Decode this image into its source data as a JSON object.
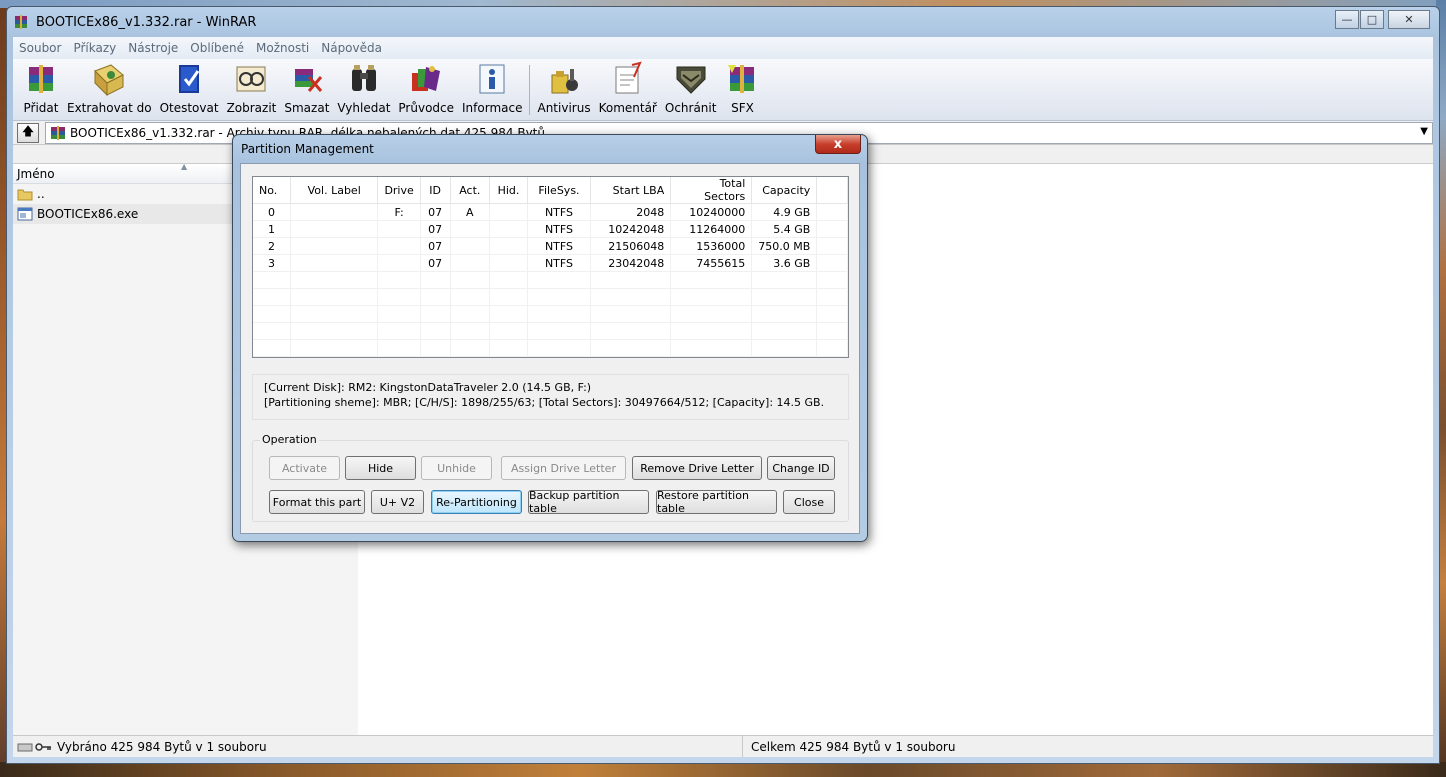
{
  "window": {
    "title": "BOOTICEx86_v1.332.rar - WinRAR",
    "min": "—",
    "max": "□",
    "close": "✕"
  },
  "menu": [
    "Soubor",
    "Příkazy",
    "Nástroje",
    "Oblíbené",
    "Možnosti",
    "Nápověda"
  ],
  "toolbar": [
    {
      "label": "Přidat",
      "icon": "add-archive-icon"
    },
    {
      "label": "Extrahovat do",
      "icon": "extract-icon"
    },
    {
      "label": "Otestovat",
      "icon": "test-icon"
    },
    {
      "label": "Zobrazit",
      "icon": "view-icon"
    },
    {
      "label": "Smazat",
      "icon": "delete-icon"
    },
    {
      "label": "Vyhledat",
      "icon": "find-icon"
    },
    {
      "label": "Průvodce",
      "icon": "wizard-icon"
    },
    {
      "label": "Informace",
      "icon": "info-icon"
    },
    {
      "label": "Antivirus",
      "icon": "antivirus-icon"
    },
    {
      "label": "Komentář",
      "icon": "comment-icon"
    },
    {
      "label": "Ochránit",
      "icon": "protect-icon"
    },
    {
      "label": "SFX",
      "icon": "sfx-icon"
    }
  ],
  "address": {
    "text": "BOOTICEx86_v1.332.rar - Archiv typu RAR, délka nebalených dat 425 984 Bytů"
  },
  "filelist": {
    "column_name": "Jméno",
    "rows": [
      {
        "name": ".."
      },
      {
        "name": "BOOTICEx86.exe"
      }
    ]
  },
  "status": {
    "left": "Vybráno 425 984 Bytů v 1 souboru",
    "right": "Celkem 425 984 Bytů v 1 souboru"
  },
  "dialog": {
    "title": "Partition Management",
    "close": "x",
    "columns": [
      "No.",
      "Vol. Label",
      "Drive",
      "ID",
      "Act.",
      "Hid.",
      "FileSys.",
      "Start LBA",
      "Total Sectors",
      "Capacity"
    ],
    "rows": [
      {
        "no": "0",
        "label": "",
        "drive": "F:",
        "id": "07",
        "act": "A",
        "hid": "",
        "fs": "NTFS",
        "start": "2048",
        "total": "10240000",
        "cap": "4.9 GB"
      },
      {
        "no": "1",
        "label": "",
        "drive": "",
        "id": "07",
        "act": "",
        "hid": "",
        "fs": "NTFS",
        "start": "10242048",
        "total": "11264000",
        "cap": "5.4 GB"
      },
      {
        "no": "2",
        "label": "",
        "drive": "",
        "id": "07",
        "act": "",
        "hid": "",
        "fs": "NTFS",
        "start": "21506048",
        "total": "1536000",
        "cap": "750.0 MB"
      },
      {
        "no": "3",
        "label": "",
        "drive": "",
        "id": "07",
        "act": "",
        "hid": "",
        "fs": "NTFS",
        "start": "23042048",
        "total": "7455615",
        "cap": "3.6 GB"
      }
    ],
    "info_line1": "[Current Disk]:    RM2: KingstonDataTraveler 2.0 (14.5 GB, F:)",
    "info_line2": "[Partitioning sheme]:     MBR;     [C/H/S]: 1898/255/63; [Total Sectors]: 30497664/512; [Capacity]: 14.5 GB.",
    "operation_label": "Operation",
    "buttons": {
      "activate": "Activate",
      "hide": "Hide",
      "unhide": "Unhide",
      "assign": "Assign Drive Letter",
      "remove": "Remove Drive Letter",
      "change_id": "Change ID",
      "format": "Format this part",
      "uv2": "U+ V2",
      "repart": "Re-Partitioning",
      "backup": "Backup partition table",
      "restore": "Restore partition table",
      "close": "Close"
    }
  }
}
